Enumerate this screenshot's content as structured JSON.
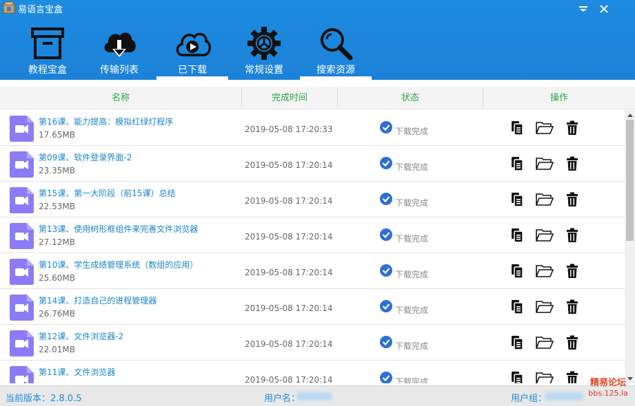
{
  "window": {
    "title": "易语言宝盒"
  },
  "nav": [
    {
      "label": "教程宝盒",
      "icon": "box-icon",
      "active": false
    },
    {
      "label": "传输列表",
      "icon": "cloud-download-icon",
      "active": false
    },
    {
      "label": "已下载",
      "icon": "cloud-play-icon",
      "active": true
    },
    {
      "label": "常规设置",
      "icon": "gear-icon",
      "active": false
    },
    {
      "label": "搜索资源",
      "icon": "search-icon",
      "active": false
    }
  ],
  "table": {
    "columns": [
      "名称",
      "完成时间",
      "状态",
      "操作"
    ],
    "rows": [
      {
        "name": "第16课、能力提高：模拟红绿灯程序",
        "size": "17.65MB",
        "time": "2019-05-08 17:20:33",
        "status": "下载完成"
      },
      {
        "name": "第09课、软件登录界面-2",
        "size": "23.35MB",
        "time": "2019-05-08 17:20:14",
        "status": "下载完成"
      },
      {
        "name": "第15课、第一大阶段（前15课）总结",
        "size": "22.53MB",
        "time": "2019-05-08 17:20:14",
        "status": "下载完成"
      },
      {
        "name": "第13课、使用树形框组件来完善文件浏览器",
        "size": "27.12MB",
        "time": "2019-05-08 17:20:14",
        "status": "下载完成"
      },
      {
        "name": "第10课、学生成绩管理系统（数组的应用）",
        "size": "25.60MB",
        "time": "2019-05-08 17:20:14",
        "status": "下载完成"
      },
      {
        "name": "第14课、打造自己的进程管理器",
        "size": "26.76MB",
        "time": "2019-05-08 17:20:14",
        "status": "下载完成"
      },
      {
        "name": "第12课、文件浏览器-2",
        "size": "22.01MB",
        "time": "2019-05-08 17:20:14",
        "status": "下载完成"
      },
      {
        "name": "第11课、文件浏览器",
        "size": "",
        "time": "2019-05-08 17:20:14",
        "status": "下载完成"
      }
    ]
  },
  "statusbar": {
    "version": "当前版本：2.8.0.5",
    "username_label": "用户名：",
    "usergroup_label": "用户组："
  },
  "watermark": {
    "line1": "精易论坛",
    "line2": "bbs.125.la"
  },
  "colors": {
    "titlebar": "#1d8be0",
    "header_text": "#2ba245",
    "file_name": "#1a84c8",
    "status_icon": "#2e6fd6",
    "file_icon": "#8b7cf6"
  }
}
